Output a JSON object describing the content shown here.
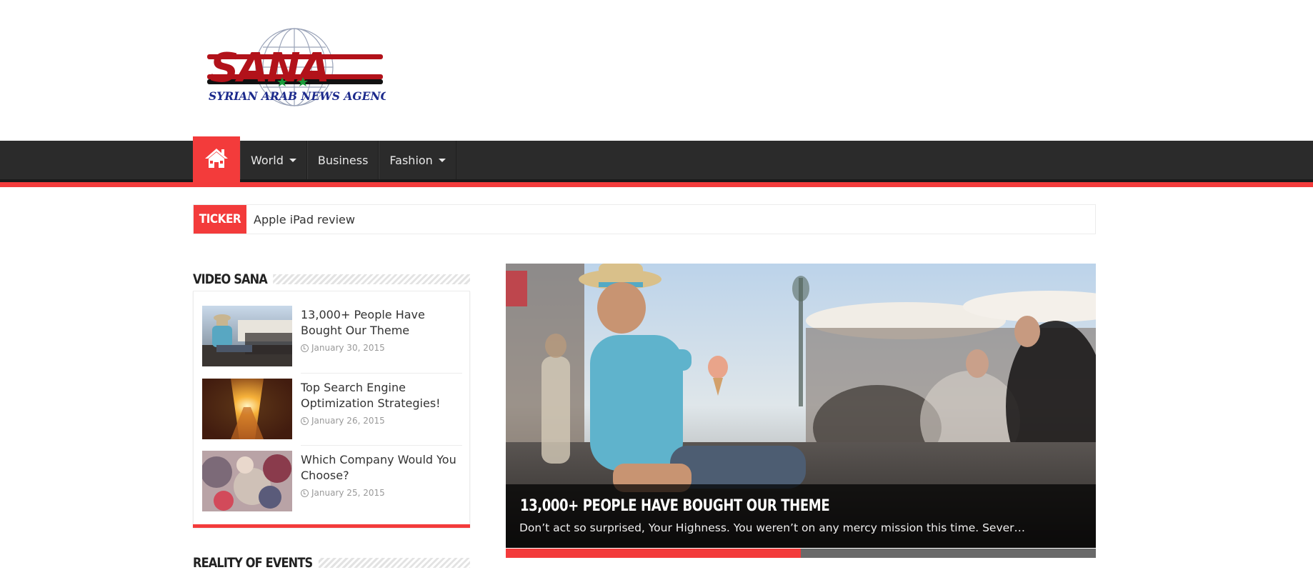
{
  "logo": {
    "wordmark": "SANA",
    "tagline": "SYRIAN ARAB NEWS AGENCY"
  },
  "nav": {
    "home_icon": "home-icon",
    "items": [
      {
        "label": "World",
        "has_dropdown": true
      },
      {
        "label": "Business",
        "has_dropdown": false
      },
      {
        "label": "Fashion",
        "has_dropdown": true
      }
    ]
  },
  "ticker": {
    "label": "TICKER",
    "text": "Apple iPad review"
  },
  "video_widget": {
    "title": "VIDEO SANA",
    "posts": [
      {
        "title": "13,000+ People Have Bought Our Theme",
        "date": "January 30, 2015"
      },
      {
        "title": "Top Search Engine Optimization Strategies!",
        "date": "January 26, 2015"
      },
      {
        "title": "Which Company Would You Choose?",
        "date": "January 25, 2015"
      }
    ]
  },
  "slider": {
    "title": "13,000+ PEOPLE HAVE BOUGHT OUR THEME",
    "excerpt": "Don’t act so surprised, Your Highness. You weren’t on any mercy mission this time. Sever…",
    "progress": 0.5
  },
  "reality_widget": {
    "title": "REALITY OF EVENTS"
  },
  "colors": {
    "accent": "#f33b3b",
    "navbar": "#2b2b2b"
  }
}
